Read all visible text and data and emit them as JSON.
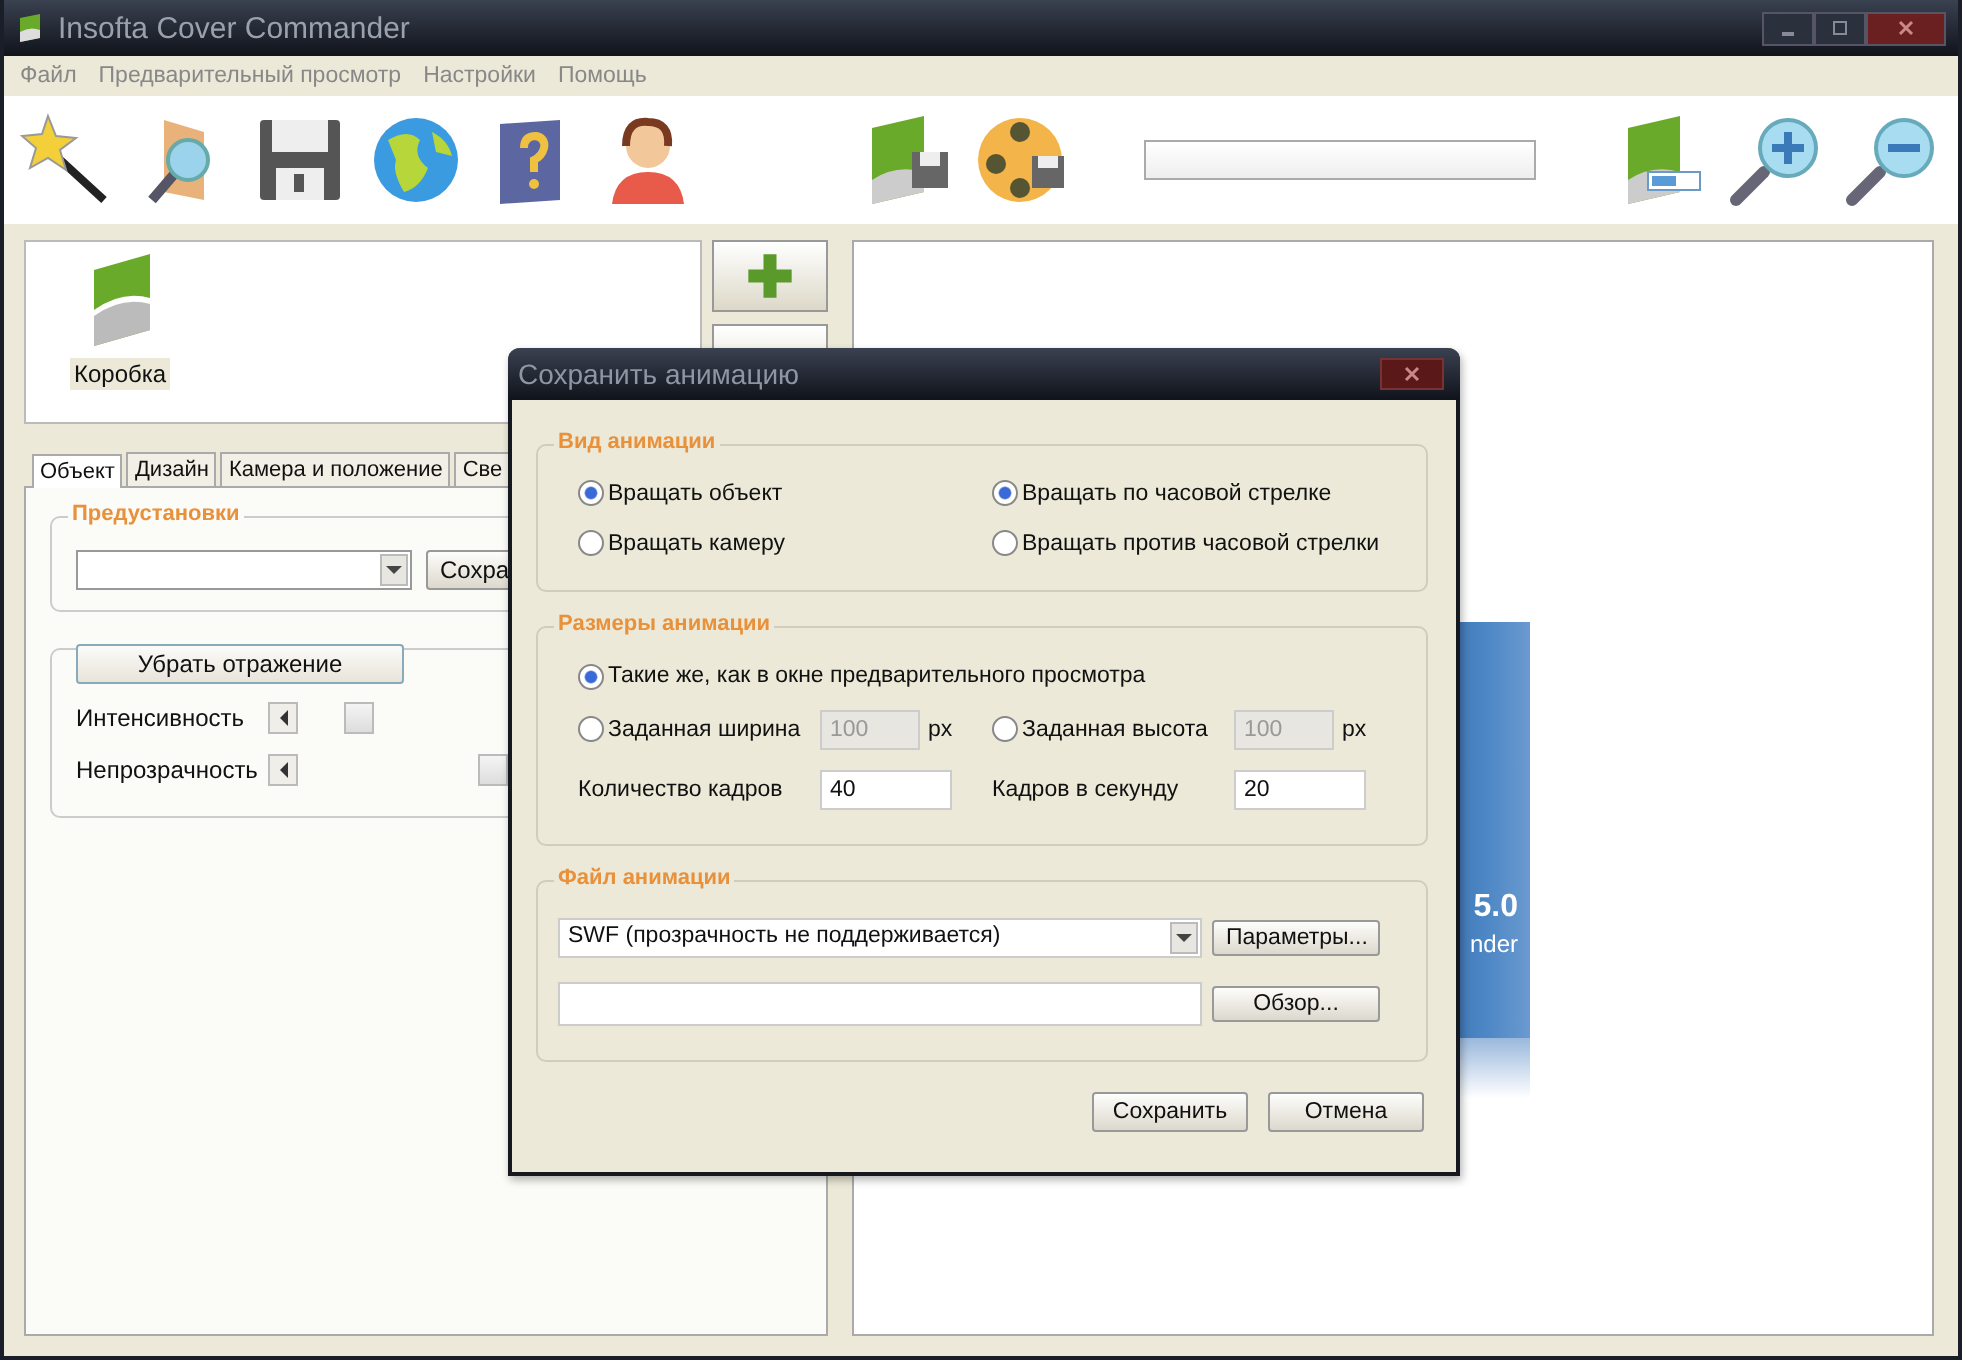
{
  "window": {
    "title": "Insofta Cover Commander"
  },
  "menu": [
    "Файл",
    "Предварительный просмотр",
    "Настройки",
    "Помощь"
  ],
  "toolbar": {
    "progress": {
      "level": 0
    }
  },
  "objects": [
    {
      "label": "Коробка",
      "selected": false
    }
  ],
  "tabs": [
    {
      "label": "Объект",
      "selected": true
    },
    {
      "label": "Дизайн",
      "selected": false
    },
    {
      "label": "Камера и положение",
      "selected": false
    },
    {
      "label": "Све",
      "selected": false
    }
  ],
  "presets": {
    "label": "Предустановки",
    "save_button": "Сохра"
  },
  "reflection": {
    "button": "Убрать отражение",
    "sliders": [
      {
        "label": "Интенсивность",
        "level": 0.08
      },
      {
        "label": "Непрозрачность",
        "level": 0.36
      }
    ]
  },
  "preview": {
    "cover_texts": [
      "5.0",
      "nder"
    ]
  },
  "dialog": {
    "title": "Сохранить анимацию",
    "mode_group": {
      "label": "Вид анимации",
      "subject_options": [
        {
          "label": "Вращать объект",
          "selected": true
        },
        {
          "label": "Вращать камеру",
          "selected": false
        }
      ],
      "direction_options": [
        {
          "label": "Вращать по часовой стрелке",
          "selected": true
        },
        {
          "label": "Вращать против часовой стрелки",
          "selected": false
        }
      ]
    },
    "size_group": {
      "label": "Размеры анимации",
      "same": {
        "label": "Такие же, как в окне предварительного просмотра",
        "selected": true
      },
      "fixed": [
        {
          "label": "Заданная ширина",
          "selected": false,
          "value": "100",
          "unit": "px",
          "disabled": true
        },
        {
          "label": "Заданная высота",
          "selected": false,
          "value": "100",
          "unit": "px",
          "disabled": true
        }
      ],
      "counts": [
        {
          "label": "Количество кадров",
          "value": "40"
        },
        {
          "label": "Кадров в секунду",
          "value": "20"
        }
      ]
    },
    "file_group": {
      "label": "Файл анимации",
      "format": "SWF (прозрачность не поддерживается)",
      "params_button": "Параметры...",
      "browse_button": "Обзор..."
    },
    "buttons": [
      "Сохранить",
      "Отмена"
    ]
  }
}
